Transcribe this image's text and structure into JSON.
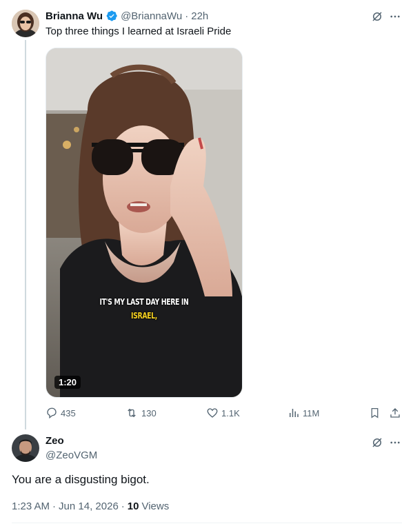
{
  "tweet": {
    "author_name": "Brianna Wu",
    "handle": "@BriannaWu",
    "separator": "·",
    "time": "22h",
    "text": "Top three things I learned at Israeli Pride",
    "video": {
      "caption_line1": "IT'S MY LAST DAY HERE IN",
      "caption_line2": "ISRAEL,",
      "duration": "1:20"
    },
    "actions": {
      "replies": "435",
      "reposts": "130",
      "likes": "1.1K",
      "views": "11M"
    }
  },
  "reply": {
    "author_name": "Zeo",
    "handle": "@ZeoVGM",
    "text": "You are a disgusting bigot.",
    "time": "1:23 AM",
    "date": "Jun 14, 2026",
    "dot": "·",
    "views_count": "10",
    "views_label": "Views"
  },
  "icons": {
    "verified": "verified-badge-icon",
    "grok": "grok-icon",
    "more": "more-icon",
    "reply": "reply-icon",
    "repost": "repost-icon",
    "like": "like-icon",
    "views": "views-icon",
    "bookmark": "bookmark-icon",
    "share": "share-icon"
  },
  "colors": {
    "text": "#0f1419",
    "muted": "#536471",
    "verified": "#1d9bf0",
    "thread_line": "#cfd9de",
    "caption_white": "#ffffff",
    "caption_yellow": "#f5d020"
  }
}
